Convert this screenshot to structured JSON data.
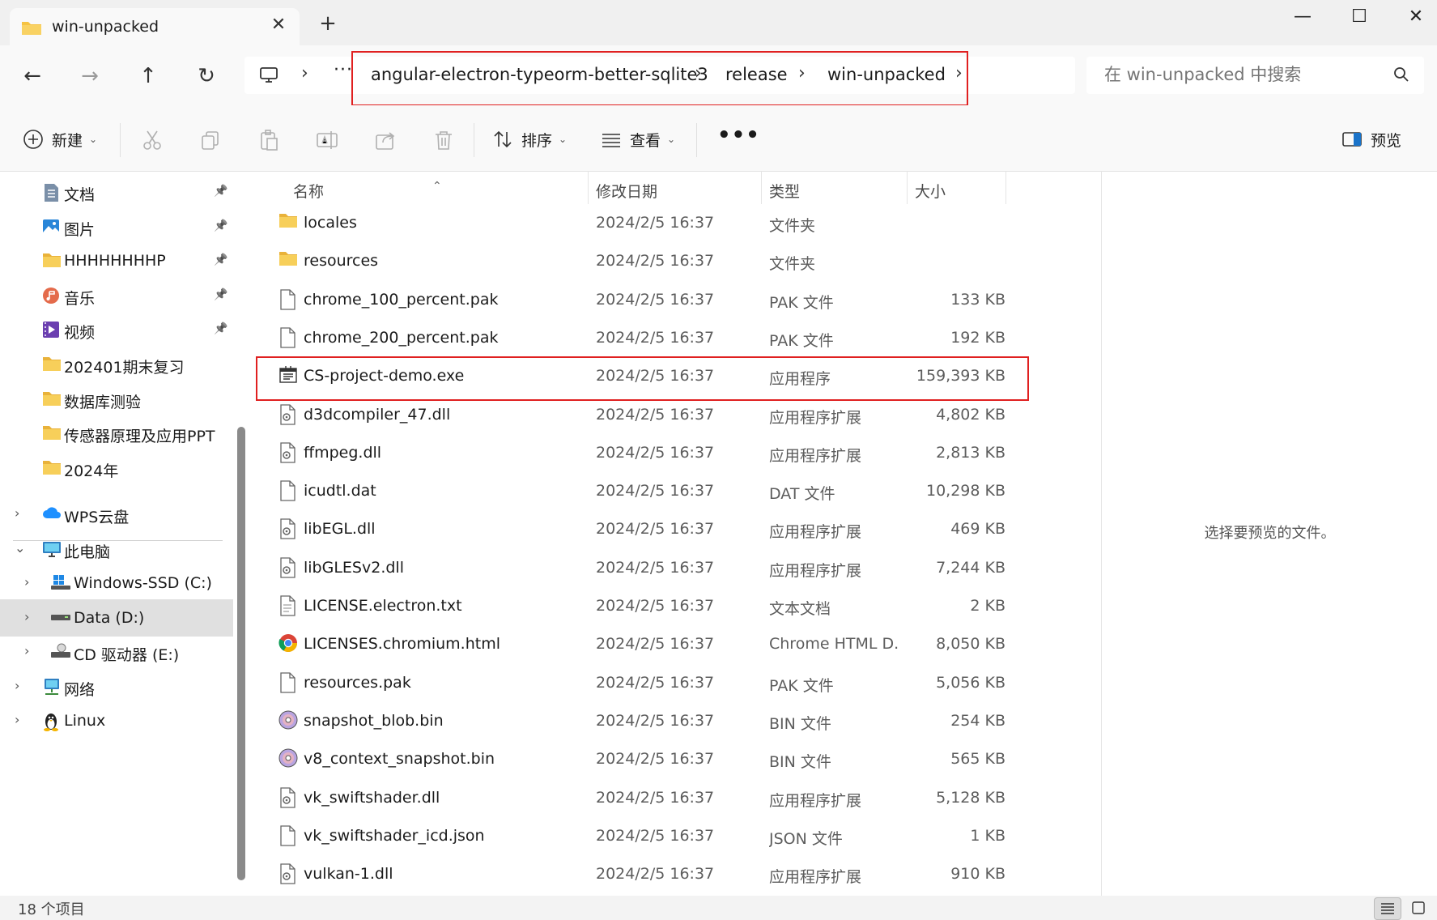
{
  "tab": {
    "title": "win-unpacked",
    "close": "✕",
    "new_tab": "+"
  },
  "window_controls": {
    "minimize": "—",
    "maximize": "☐",
    "close": "✕"
  },
  "nav": {
    "back": "←",
    "forward": "→",
    "up": "↑",
    "refresh": "↻"
  },
  "address": {
    "more": "···",
    "crumbs": [
      "angular-electron-typeorm-better-sqlite3",
      "release",
      "win-unpacked"
    ]
  },
  "search": {
    "placeholder": "在 win-unpacked 中搜索"
  },
  "commands": {
    "new": "新建",
    "sort": "排序",
    "view": "查看",
    "more": "•••",
    "preview": "预览"
  },
  "sidebar": {
    "pinned": [
      {
        "label": "文档",
        "icon": "document-icon",
        "pinned": true
      },
      {
        "label": "图片",
        "icon": "pictures-icon",
        "pinned": true
      },
      {
        "label": "HHHHHHHHP",
        "icon": "folder-icon",
        "pinned": true
      },
      {
        "label": "音乐",
        "icon": "music-icon",
        "pinned": true
      },
      {
        "label": "视频",
        "icon": "video-icon",
        "pinned": true
      },
      {
        "label": "202401期末复习",
        "icon": "folder-icon",
        "pinned": false
      },
      {
        "label": "数据库测验",
        "icon": "folder-icon",
        "pinned": false
      },
      {
        "label": "传感器原理及应用PPT",
        "icon": "folder-icon",
        "pinned": false
      },
      {
        "label": "2024年",
        "icon": "folder-icon",
        "pinned": false
      }
    ],
    "tree": [
      {
        "label": "WPS云盘",
        "icon": "cloud-icon",
        "chevron": "›",
        "sub": false
      },
      {
        "label": "此电脑",
        "icon": "computer-icon",
        "chevron": "⌄",
        "sub": false
      },
      {
        "label": "Windows-SSD (C:)",
        "icon": "windows-drive-icon",
        "chevron": "›",
        "sub": true
      },
      {
        "label": "Data (D:)",
        "icon": "drive-icon",
        "chevron": "›",
        "sub": true,
        "selected": true
      },
      {
        "label": "CD 驱动器 (E:)",
        "icon": "cd-drive-icon",
        "chevron": "›",
        "sub": true
      },
      {
        "label": "网络",
        "icon": "network-icon",
        "chevron": "›",
        "sub": false
      },
      {
        "label": "Linux",
        "icon": "linux-icon",
        "chevron": "›",
        "sub": false
      }
    ]
  },
  "columns": {
    "name": "名称",
    "date": "修改日期",
    "type": "类型",
    "size": "大小"
  },
  "files": [
    {
      "name": "locales",
      "date": "2024/2/5 16:37",
      "type": "文件夹",
      "size": "",
      "icon": "folder-icon"
    },
    {
      "name": "resources",
      "date": "2024/2/5 16:37",
      "type": "文件夹",
      "size": "",
      "icon": "folder-icon"
    },
    {
      "name": "chrome_100_percent.pak",
      "date": "2024/2/5 16:37",
      "type": "PAK 文件",
      "size": "133 KB",
      "icon": "file-icon"
    },
    {
      "name": "chrome_200_percent.pak",
      "date": "2024/2/5 16:37",
      "type": "PAK 文件",
      "size": "192 KB",
      "icon": "file-icon"
    },
    {
      "name": "CS-project-demo.exe",
      "date": "2024/2/5 16:37",
      "type": "应用程序",
      "size": "159,393 KB",
      "icon": "exe-icon"
    },
    {
      "name": "d3dcompiler_47.dll",
      "date": "2024/2/5 16:37",
      "type": "应用程序扩展",
      "size": "4,802 KB",
      "icon": "dll-icon"
    },
    {
      "name": "ffmpeg.dll",
      "date": "2024/2/5 16:37",
      "type": "应用程序扩展",
      "size": "2,813 KB",
      "icon": "dll-icon"
    },
    {
      "name": "icudtl.dat",
      "date": "2024/2/5 16:37",
      "type": "DAT 文件",
      "size": "10,298 KB",
      "icon": "file-icon"
    },
    {
      "name": "libEGL.dll",
      "date": "2024/2/5 16:37",
      "type": "应用程序扩展",
      "size": "469 KB",
      "icon": "dll-icon"
    },
    {
      "name": "libGLESv2.dll",
      "date": "2024/2/5 16:37",
      "type": "应用程序扩展",
      "size": "7,244 KB",
      "icon": "dll-icon"
    },
    {
      "name": "LICENSE.electron.txt",
      "date": "2024/2/5 16:37",
      "type": "文本文档",
      "size": "2 KB",
      "icon": "text-file-icon"
    },
    {
      "name": "LICENSES.chromium.html",
      "date": "2024/2/5 16:37",
      "type": "Chrome HTML D...",
      "size": "8,050 KB",
      "icon": "chrome-icon"
    },
    {
      "name": "resources.pak",
      "date": "2024/2/5 16:37",
      "type": "PAK 文件",
      "size": "5,056 KB",
      "icon": "file-icon"
    },
    {
      "name": "snapshot_blob.bin",
      "date": "2024/2/5 16:37",
      "type": "BIN 文件",
      "size": "254 KB",
      "icon": "disc-icon"
    },
    {
      "name": "v8_context_snapshot.bin",
      "date": "2024/2/5 16:37",
      "type": "BIN 文件",
      "size": "565 KB",
      "icon": "disc-icon"
    },
    {
      "name": "vk_swiftshader.dll",
      "date": "2024/2/5 16:37",
      "type": "应用程序扩展",
      "size": "5,128 KB",
      "icon": "dll-icon"
    },
    {
      "name": "vk_swiftshader_icd.json",
      "date": "2024/2/5 16:37",
      "type": "JSON 文件",
      "size": "1 KB",
      "icon": "file-icon"
    },
    {
      "name": "vulkan-1.dll",
      "date": "2024/2/5 16:37",
      "type": "应用程序扩展",
      "size": "910 KB",
      "icon": "dll-icon"
    }
  ],
  "preview": {
    "message": "选择要预览的文件。"
  },
  "status": {
    "count": "18 个项目"
  },
  "colors": {
    "highlight": "#e02020",
    "folder": "#f6c343"
  }
}
